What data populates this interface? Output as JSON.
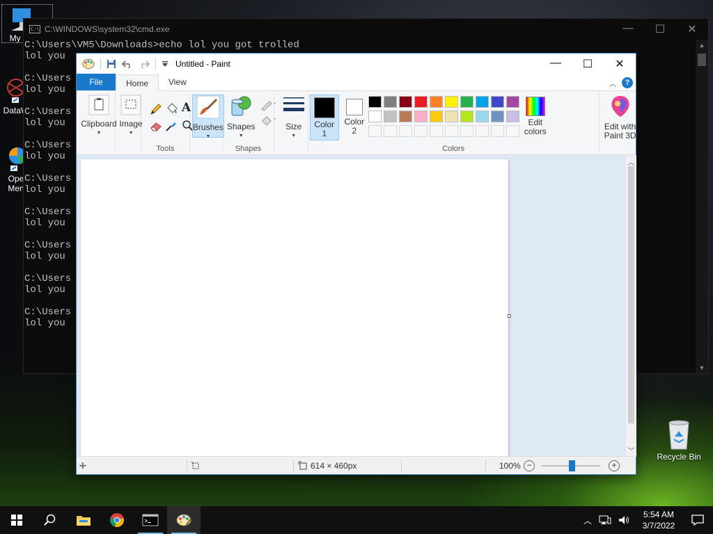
{
  "desktop": {
    "icons": [
      {
        "label": "My Co",
        "icon": "computer-icon"
      },
      {
        "label": "DataW",
        "icon": "datawarrior-icon"
      },
      {
        "label": "Open Menu",
        "line1": "Ope",
        "line2": "Men",
        "icon": "open-menu-icon"
      },
      {
        "label": "Recycle Bin",
        "icon": "recycle-bin-icon"
      }
    ]
  },
  "cmd": {
    "title": "C:\\WINDOWS\\system32\\cmd.exe",
    "first_line": "C:\\Users\\VM5\\Downloads>echo lol you got trolled",
    "prompt_partial": "C:\\Users",
    "output_partial": "lol you",
    "controls": {
      "minimize": "—",
      "maximize": "☐",
      "close": "✕"
    }
  },
  "paint": {
    "title": "Untitled - Paint",
    "tabs": {
      "file": "File",
      "home": "Home",
      "view": "View"
    },
    "groups": {
      "clipboard": "Clipboard",
      "image": "Image",
      "tools": "Tools",
      "brushes": "Brushes",
      "shapes_btn": "Shapes",
      "shapes_group": "Shapes",
      "size": "Size",
      "color1_line1": "Color",
      "color1_line2": "1",
      "color2_line1": "Color",
      "color2_line2": "2",
      "colors": "Colors",
      "edit_colors_line1": "Edit",
      "edit_colors_line2": "colors",
      "edit_paint3d_line1": "Edit with",
      "edit_paint3d_line2": "Paint 3D"
    },
    "palette_row1": [
      "#000000",
      "#7f7f7f",
      "#880015",
      "#ed1c24",
      "#ff7f27",
      "#fff200",
      "#22b14c",
      "#00a2e8",
      "#3f48cc",
      "#a349a4"
    ],
    "palette_row2": [
      "#ffffff",
      "#c3c3c3",
      "#b97a57",
      "#ffaec9",
      "#ffc90e",
      "#efe4b0",
      "#b5e61d",
      "#99d9ea",
      "#7092be",
      "#c8bfe7"
    ],
    "palette_row3_count": 10,
    "color1": "#000000",
    "color2": "#ffffff",
    "status": {
      "dimensions": "614 × 460px",
      "zoom": "100%"
    }
  },
  "taskbar": {
    "apps": [
      "start-icon",
      "search-icon",
      "file-explorer-icon",
      "chrome-icon",
      "cmd-icon",
      "paint-icon"
    ],
    "time": "5:54 AM",
    "date": "3/7/2022"
  }
}
